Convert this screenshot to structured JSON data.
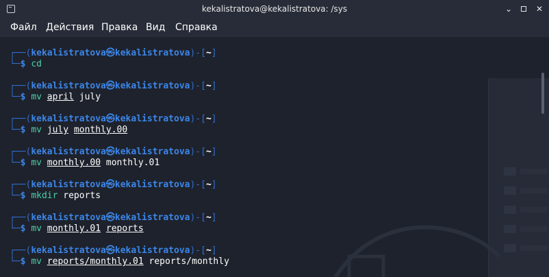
{
  "window": {
    "title": "kekalistratova@kekalistratova: /sys",
    "minimize_glyph": "⌄",
    "maximize_glyph": "",
    "close_glyph": "✕"
  },
  "menu": [
    "Файл",
    "Действия",
    "Правка",
    "Вид",
    "Справка"
  ],
  "prompt": {
    "open": "┌──(",
    "user": "kekalistratova",
    "at": "㉿",
    "host": "kekalistratova",
    "mid": ")-[",
    "path": "~",
    "close": "]",
    "second": "└─",
    "dollar": "$"
  },
  "history": [
    {
      "cmd": "cd",
      "args": []
    },
    {
      "cmd": "mv",
      "args": [
        {
          "text": "april",
          "u": true
        },
        {
          "text": "july",
          "u": false
        }
      ]
    },
    {
      "cmd": "mv",
      "args": [
        {
          "text": "july",
          "u": true
        },
        {
          "text": "monthly.00",
          "u": true
        }
      ]
    },
    {
      "cmd": "mv",
      "args": [
        {
          "text": "monthly.00",
          "u": true
        },
        {
          "text": "monthly.01",
          "u": false
        }
      ]
    },
    {
      "cmd": "mkdir",
      "args": [
        {
          "text": "reports",
          "u": false
        }
      ]
    },
    {
      "cmd": "mv",
      "args": [
        {
          "text": "monthly.01",
          "u": true
        },
        {
          "text": "reports",
          "u": true
        }
      ]
    },
    {
      "cmd": "mv",
      "args": [
        {
          "text": "reports/monthly.01",
          "u": true
        },
        {
          "text": "reports/monthly",
          "u": false
        }
      ]
    }
  ],
  "colors": {
    "prompt_blue": "#3c86e8",
    "command_green": "#4dd0a8",
    "background": "#1e222c"
  }
}
